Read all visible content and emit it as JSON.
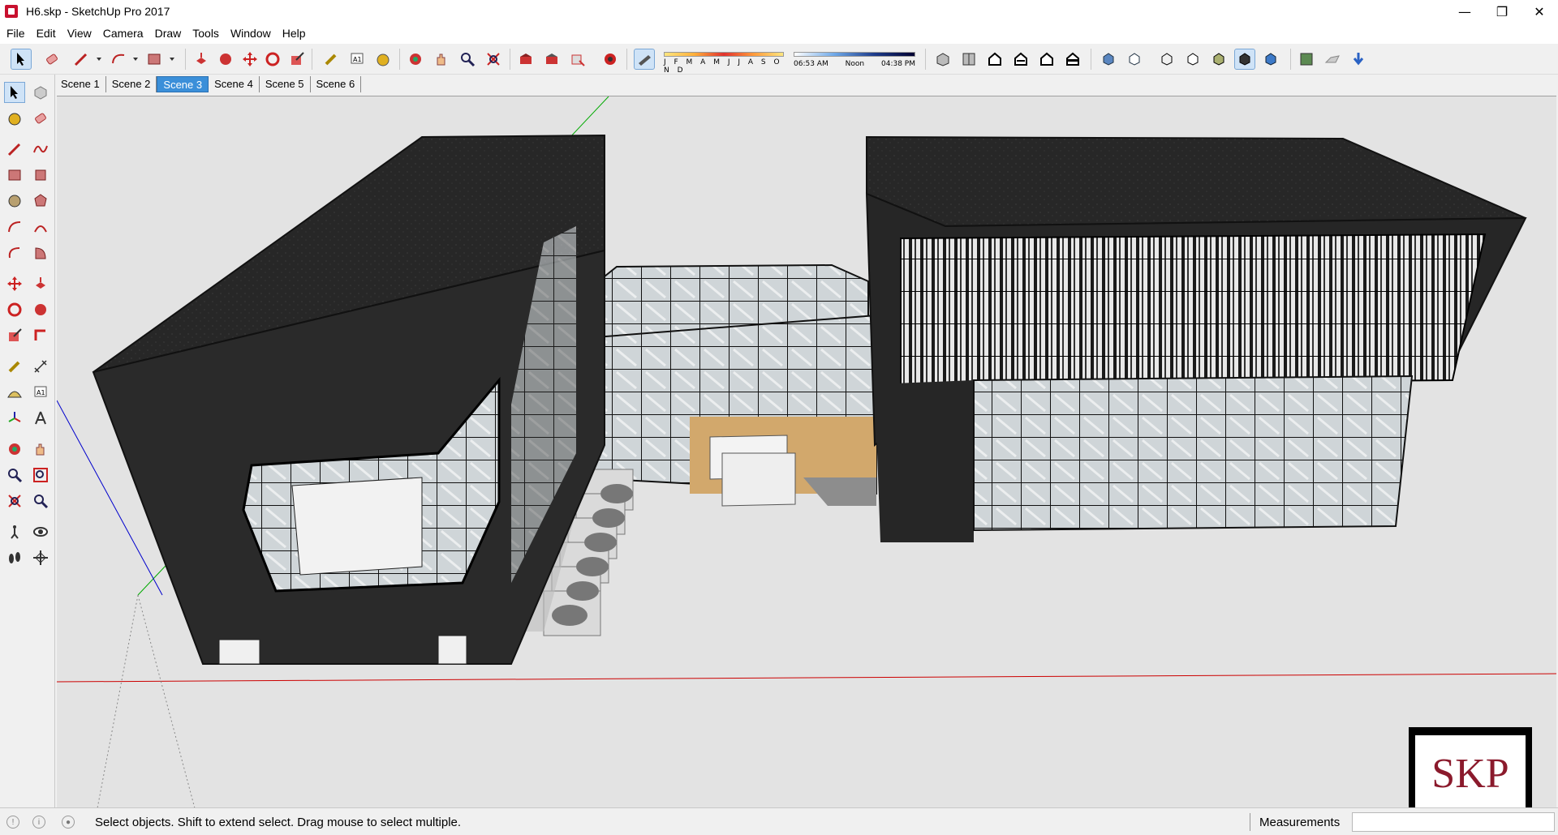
{
  "window": {
    "title": "H6.skp - SketchUp Pro 2017",
    "minimize_glyph": "—",
    "maximize_glyph": "❐",
    "close_glyph": "✕"
  },
  "menu": [
    "File",
    "Edit",
    "View",
    "Camera",
    "Draw",
    "Tools",
    "Window",
    "Help"
  ],
  "shadow_settings": {
    "months": "J F M A M J J A S O N D",
    "time_start": "06:53 AM",
    "time_noon": "Noon",
    "time_end": "04:38 PM"
  },
  "scenes": {
    "tabs": [
      "Scene 1",
      "Scene 2",
      "Scene 3",
      "Scene 4",
      "Scene 5",
      "Scene 6"
    ],
    "active": "Scene 3"
  },
  "status": {
    "hint": "Select objects. Shift to extend select. Drag mouse to select multiple.",
    "measurements_label": "Measurements",
    "measurements_value": ""
  },
  "watermark": {
    "text": "SKP",
    "color": "#8b1a2c"
  },
  "colors": {
    "axis_red": "#cc0000",
    "axis_green": "#00aa00",
    "axis_blue": "#0000cc",
    "building_dark": "#262626",
    "wood_panel": "#d2a86c",
    "active_tab": "#3b8fd9"
  }
}
